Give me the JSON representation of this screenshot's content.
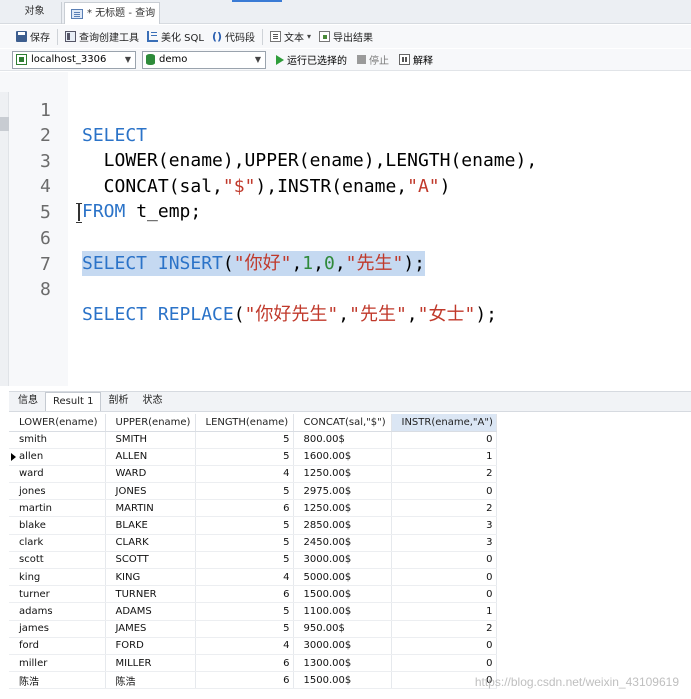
{
  "tabs": {
    "objects": "对象",
    "query": "* 无标题 - 查询"
  },
  "toolbar": {
    "save": "保存",
    "query_builder": "查询创建工具",
    "beautify_sql": "美化 SQL",
    "code_snippet_paren": "()",
    "code_snippet": "代码段",
    "text": "文本",
    "export_results": "导出结果"
  },
  "connection": {
    "server": "localhost_3306",
    "database": "demo",
    "run_selected": "运行已选择的",
    "stop": "停止",
    "explain": "解释"
  },
  "editor": {
    "line_numbers": [
      "1",
      "2",
      "3",
      "4",
      "5",
      "6",
      "7",
      "8"
    ],
    "line1": {
      "kw": "SELECT"
    },
    "line2": {
      "code": "  LOWER(ename),UPPER(ename),LENGTH(ename),"
    },
    "line3": {
      "a": "  CONCAT(sal,",
      "s1": "\"$\"",
      "b": "),INSTR(ename,",
      "s2": "\"A\"",
      "c": ")"
    },
    "line4": {
      "kw": "FROM",
      "rest": " t_emp;"
    },
    "line6": {
      "kw1": "SELECT",
      "sp": " ",
      "kw2": "INSERT",
      "p1": "(",
      "s1": "\"你好\"",
      "c1": ",",
      "n1": "1",
      "c2": ",",
      "n2": "0",
      "c3": ",",
      "s2": "\"先生\"",
      "p2": ");"
    },
    "line8": {
      "kw1": "SELECT",
      "sp": " ",
      "kw2": "REPLACE",
      "p1": "(",
      "s1": "\"你好先生\"",
      "c1": ",",
      "s2": "\"先生\"",
      "c2": ",",
      "s3": "\"女士\"",
      "p2": ");"
    }
  },
  "result_tabs": [
    "信息",
    "Result 1",
    "剖析",
    "状态"
  ],
  "grid": {
    "columns": [
      "LOWER(ename)",
      "UPPER(ename)",
      "LENGTH(ename)",
      "CONCAT(sal,\"$\")",
      "INSTR(ename,\"A\")"
    ],
    "rows": [
      [
        "smith",
        "SMITH",
        "5",
        "800.00$",
        "0"
      ],
      [
        "allen",
        "ALLEN",
        "5",
        "1600.00$",
        "1"
      ],
      [
        "ward",
        "WARD",
        "4",
        "1250.00$",
        "2"
      ],
      [
        "jones",
        "JONES",
        "5",
        "2975.00$",
        "0"
      ],
      [
        "martin",
        "MARTIN",
        "6",
        "1250.00$",
        "2"
      ],
      [
        "blake",
        "BLAKE",
        "5",
        "2850.00$",
        "3"
      ],
      [
        "clark",
        "CLARK",
        "5",
        "2450.00$",
        "3"
      ],
      [
        "scott",
        "SCOTT",
        "5",
        "3000.00$",
        "0"
      ],
      [
        "king",
        "KING",
        "4",
        "5000.00$",
        "0"
      ],
      [
        "turner",
        "TURNER",
        "6",
        "1500.00$",
        "0"
      ],
      [
        "adams",
        "ADAMS",
        "5",
        "1100.00$",
        "1"
      ],
      [
        "james",
        "JAMES",
        "5",
        "950.00$",
        "2"
      ],
      [
        "ford",
        "FORD",
        "4",
        "3000.00$",
        "0"
      ],
      [
        "miller",
        "MILLER",
        "6",
        "1300.00$",
        "0"
      ],
      [
        "陈浩",
        "陈浩",
        "6",
        "1500.00$",
        "0"
      ]
    ]
  },
  "watermark": "https://blog.csdn.net/weixin_43109619"
}
